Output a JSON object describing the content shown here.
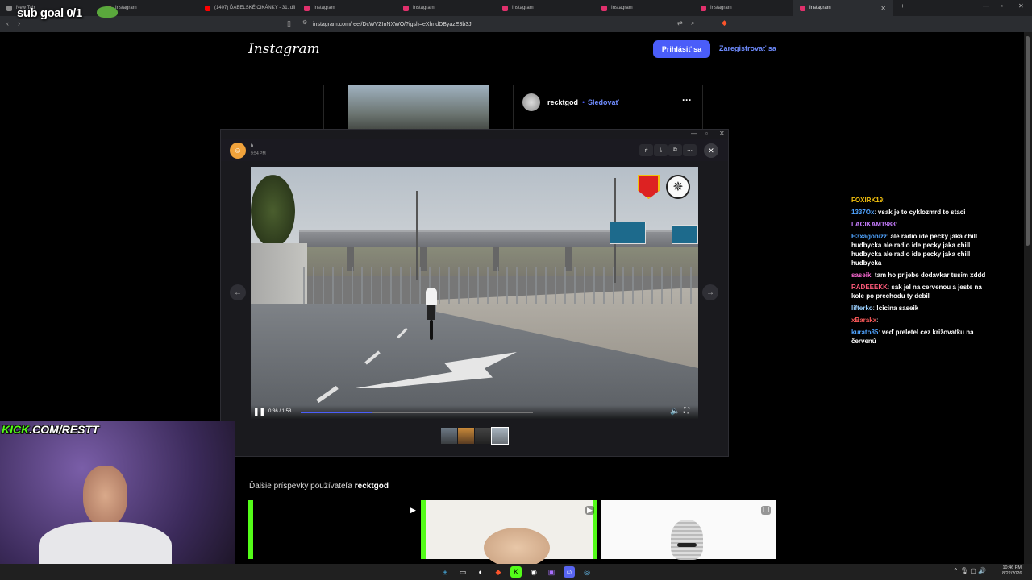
{
  "browser": {
    "tabs": [
      {
        "label": "New Tab",
        "icon_color": "#8a8a8a"
      },
      {
        "label": "Instagram",
        "icon_color": "#e1306c"
      },
      {
        "label": "(1407) ĎÁBELSKÉ CIKÁNKY - 31. díl",
        "icon_color": "#ff0000"
      },
      {
        "label": "Instagram",
        "icon_color": "#e1306c"
      },
      {
        "label": "Instagram",
        "icon_color": "#e1306c"
      },
      {
        "label": "Instagram",
        "icon_color": "#e1306c"
      },
      {
        "label": "Instagram",
        "icon_color": "#e1306c"
      },
      {
        "label": "Instagram",
        "icon_color": "#e1306c"
      },
      {
        "label": "Instagram",
        "icon_color": "#e1306c",
        "active": true
      }
    ],
    "url": "instagram.com/reel/DcWVZInNXWO/?igsh=eXhndDByazE3b3Ji"
  },
  "instagram": {
    "logo": "Instagram",
    "login_label": "Prihlásiť sa",
    "signup_label": "Zaregistrovať sa",
    "post_username": "recktgod",
    "follow_dot": "•",
    "follow_label": "Sledovať",
    "more_label": "···",
    "more_posts_prefix": "Ďalšie príspevky používateľa",
    "more_posts_user": "recktgod"
  },
  "viewer": {
    "sender": "h...",
    "time": "9:54 PM",
    "video_time": "0:36 / 1:58",
    "progress": 0.305
  },
  "overlay": {
    "sub_goal": "sub goal 0/1",
    "kick_prefix": "KICK",
    "kick_rest": ".COM/RESTT"
  },
  "chat": {
    "messages": [
      {
        "user": "FOXIRK19",
        "text": "",
        "color": "#f4c20d"
      },
      {
        "user": "1337Ox",
        "text": "vsak je to cyklozmrd to staci",
        "color": "#4fa3ff"
      },
      {
        "user": "LACIKAM1988",
        "text": "",
        "color": "#c77dff"
      },
      {
        "user": "H3xagonizz",
        "text": "ale radio ide pecky jaka chill hudbycka ale radio ide pecky jaka chill hudbycka ale radio ide pecky jaka chill hudbycka",
        "color": "#4fa3ff"
      },
      {
        "user": "saseik",
        "text": "tam ho prijebe dodavkar tusim xddd",
        "color": "#ff6ad5"
      },
      {
        "user": "RADEEEKK",
        "text": "sak jel na cervenou a jeste na kole po prechodu ty debil",
        "color": "#ff5a7a"
      },
      {
        "user": "lifterko",
        "text": "!cicina saseik",
        "color": "#9ad0ff"
      },
      {
        "user": "xBarakx",
        "text": "",
        "color": "#ff5a5a"
      },
      {
        "user": "kurato85",
        "text": "veď preletel cez križovatku na červenú",
        "color": "#4fa3ff"
      }
    ]
  },
  "taskbar": {
    "time": "10:46 PM",
    "date": "8/22/2026"
  },
  "colors": {
    "accent": "#4a5df9",
    "kick_green": "#53fc18"
  }
}
